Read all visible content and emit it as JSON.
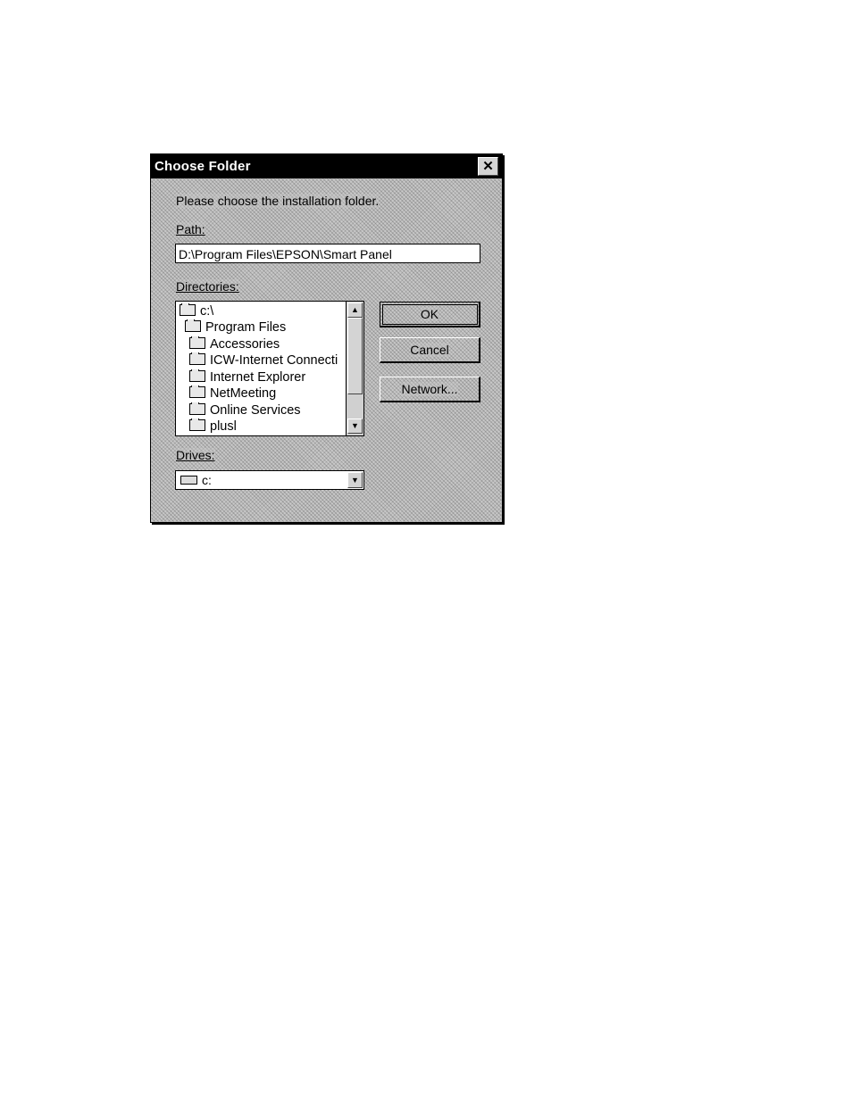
{
  "dialog": {
    "title": "Choose Folder",
    "close_glyph": "✕",
    "prompt": "Please choose the installation folder.",
    "path_label": "Path:",
    "path_value": "D:\\Program Files\\EPSON\\Smart Panel",
    "directories_label": "Directories:",
    "directories": [
      {
        "label": "c:\\",
        "icon": "open-folder-icon",
        "indent": 0
      },
      {
        "label": "Program Files",
        "icon": "open-folder-icon",
        "indent": 1
      },
      {
        "label": "Accessories",
        "icon": "folder-icon",
        "indent": 2
      },
      {
        "label": "ICW-Internet Connecti",
        "icon": "folder-icon",
        "indent": 2
      },
      {
        "label": "Internet Explorer",
        "icon": "folder-icon",
        "indent": 2
      },
      {
        "label": "NetMeeting",
        "icon": "folder-icon",
        "indent": 2
      },
      {
        "label": "Online Services",
        "icon": "folder-icon",
        "indent": 2
      },
      {
        "label": "plusl",
        "icon": "folder-icon",
        "indent": 2
      }
    ],
    "scroll_up_glyph": "▲",
    "scroll_down_glyph": "▼",
    "buttons": {
      "ok": "OK",
      "cancel": "Cancel",
      "network": "Network..."
    },
    "drives_label": "Drives:",
    "drive_value": "c:",
    "drive_dropdown_glyph": "▼"
  }
}
